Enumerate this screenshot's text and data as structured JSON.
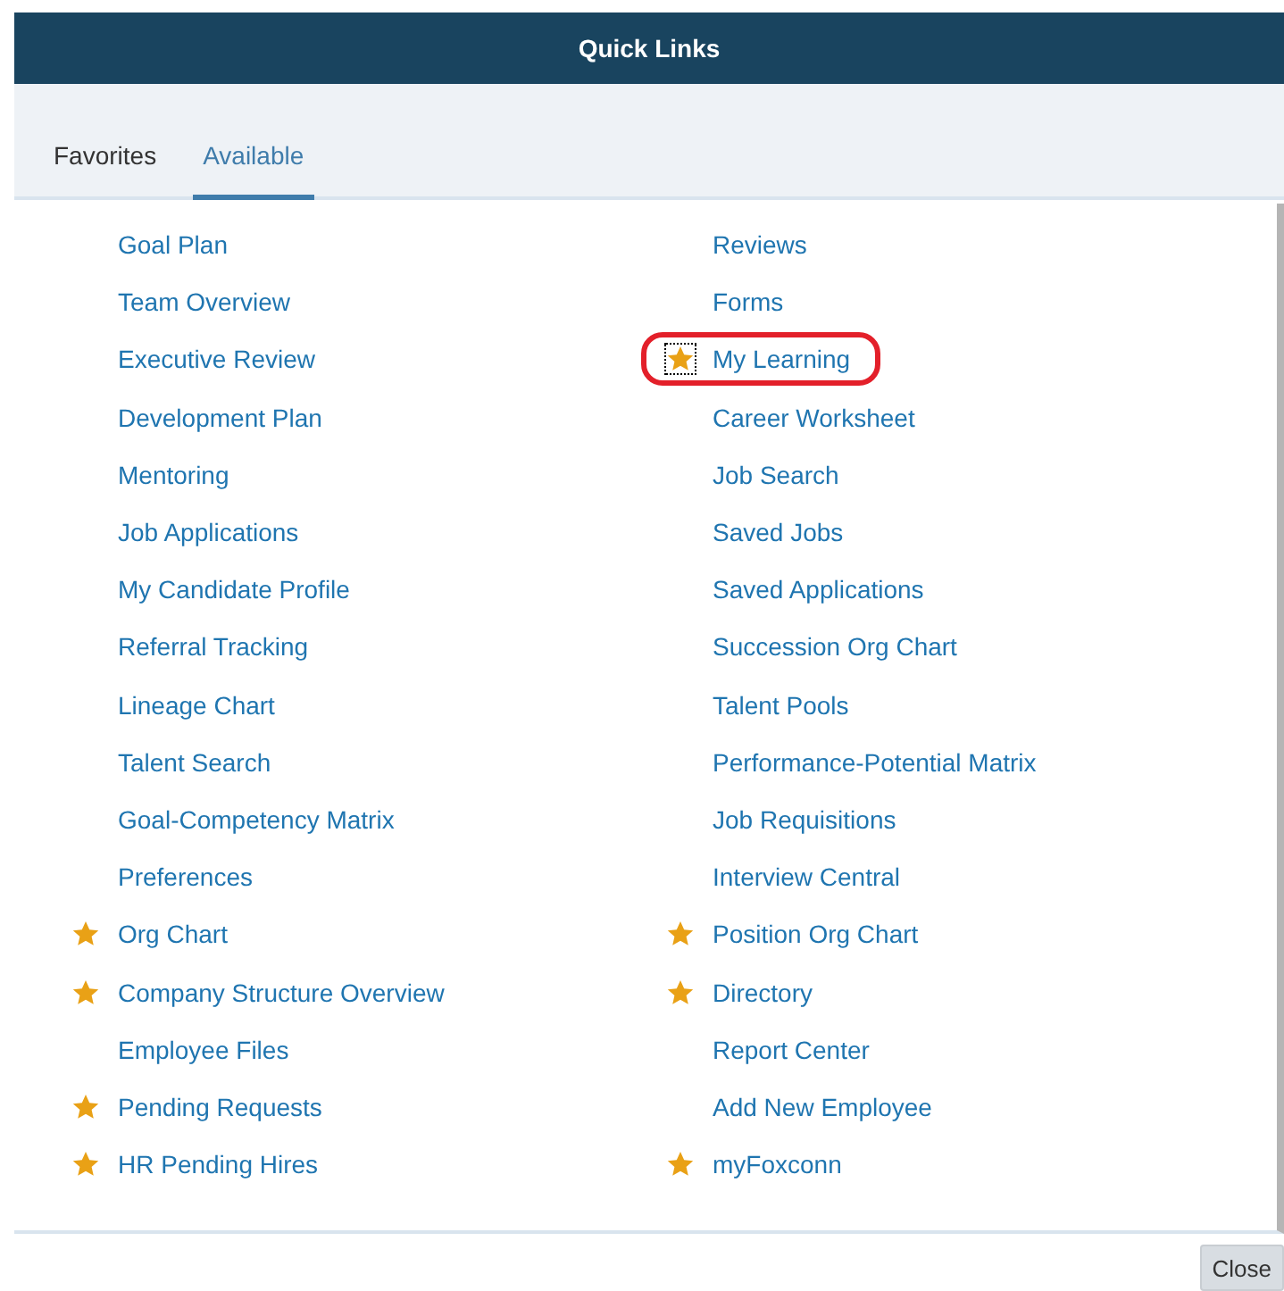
{
  "dialog": {
    "title": "Quick Links"
  },
  "tabs": [
    {
      "label": "Favorites",
      "selected": false
    },
    {
      "label": "Available",
      "selected": true
    }
  ],
  "columns": [
    {
      "links": [
        {
          "label": "Goal Plan",
          "favorite": false,
          "focused": false,
          "highlighted": false
        },
        {
          "label": "Team Overview",
          "favorite": false,
          "focused": false,
          "highlighted": false
        },
        {
          "label": "Executive Review",
          "favorite": false,
          "focused": false,
          "highlighted": false
        },
        {
          "label": "Development Plan",
          "favorite": false,
          "focused": false,
          "highlighted": false
        },
        {
          "label": "Mentoring",
          "favorite": false,
          "focused": false,
          "highlighted": false
        },
        {
          "label": "Job Applications",
          "favorite": false,
          "focused": false,
          "highlighted": false
        },
        {
          "label": "My Candidate Profile",
          "favorite": false,
          "focused": false,
          "highlighted": false
        },
        {
          "label": "Referral Tracking",
          "favorite": false,
          "focused": false,
          "highlighted": false
        },
        {
          "label": "Lineage Chart",
          "favorite": false,
          "focused": false,
          "highlighted": false
        },
        {
          "label": "Talent Search",
          "favorite": false,
          "focused": false,
          "highlighted": false
        },
        {
          "label": "Goal-Competency Matrix",
          "favorite": false,
          "focused": false,
          "highlighted": false
        },
        {
          "label": "Preferences",
          "favorite": false,
          "focused": false,
          "highlighted": false
        },
        {
          "label": "Org Chart",
          "favorite": true,
          "focused": false,
          "highlighted": false
        },
        {
          "label": "Company Structure Overview",
          "favorite": true,
          "focused": false,
          "highlighted": false
        },
        {
          "label": "Employee Files",
          "favorite": false,
          "focused": false,
          "highlighted": false
        },
        {
          "label": "Pending Requests",
          "favorite": true,
          "focused": false,
          "highlighted": false
        },
        {
          "label": "HR Pending Hires",
          "favorite": true,
          "focused": false,
          "highlighted": false
        }
      ]
    },
    {
      "links": [
        {
          "label": "Reviews",
          "favorite": false,
          "focused": false,
          "highlighted": false
        },
        {
          "label": "Forms",
          "favorite": false,
          "focused": false,
          "highlighted": false
        },
        {
          "label": "My Learning",
          "favorite": true,
          "focused": true,
          "highlighted": true
        },
        {
          "label": "Career Worksheet",
          "favorite": false,
          "focused": false,
          "highlighted": false
        },
        {
          "label": "Job Search",
          "favorite": false,
          "focused": false,
          "highlighted": false
        },
        {
          "label": "Saved Jobs",
          "favorite": false,
          "focused": false,
          "highlighted": false
        },
        {
          "label": "Saved Applications",
          "favorite": false,
          "focused": false,
          "highlighted": false
        },
        {
          "label": "Succession Org Chart",
          "favorite": false,
          "focused": false,
          "highlighted": false
        },
        {
          "label": "Talent Pools",
          "favorite": false,
          "focused": false,
          "highlighted": false
        },
        {
          "label": "Performance-Potential Matrix",
          "favorite": false,
          "focused": false,
          "highlighted": false
        },
        {
          "label": "Job Requisitions",
          "favorite": false,
          "focused": false,
          "highlighted": false
        },
        {
          "label": "Interview Central",
          "favorite": false,
          "focused": false,
          "highlighted": false
        },
        {
          "label": "Position Org Chart",
          "favorite": true,
          "focused": false,
          "highlighted": false
        },
        {
          "label": "Directory",
          "favorite": true,
          "focused": false,
          "highlighted": false
        },
        {
          "label": "Report Center",
          "favorite": false,
          "focused": false,
          "highlighted": false
        },
        {
          "label": "Add New Employee",
          "favorite": false,
          "focused": false,
          "highlighted": false
        },
        {
          "label": "myFoxconn",
          "favorite": true,
          "focused": false,
          "highlighted": false
        }
      ]
    }
  ],
  "buttons": [
    "Close"
  ]
}
